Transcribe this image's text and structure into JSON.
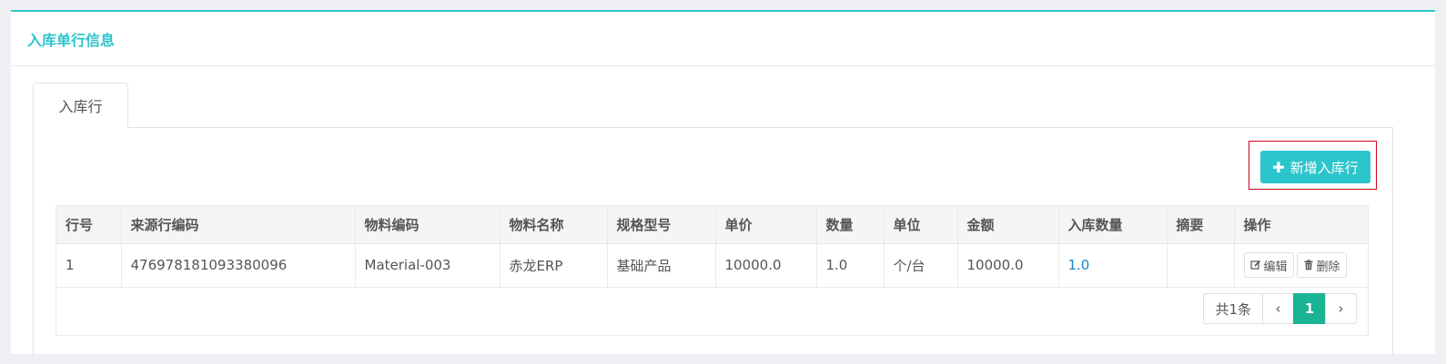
{
  "panel": {
    "title": "入库单行信息"
  },
  "tabs": [
    {
      "label": "入库行"
    }
  ],
  "toolbar": {
    "add_label": "新增入库行",
    "add_icon": "plus-icon"
  },
  "table": {
    "columns": [
      "行号",
      "来源行编码",
      "物料编码",
      "物料名称",
      "规格型号",
      "单价",
      "数量",
      "单位",
      "金额",
      "入库数量",
      "摘要",
      "操作"
    ],
    "rows": [
      {
        "line_no": "1",
        "source_code": "476978181093380096",
        "material_code": "Material-003",
        "material_name": "赤龙ERP",
        "spec": "基础产品",
        "unit_price": "10000.0",
        "quantity": "1.0",
        "unit": "个/台",
        "amount": "10000.0",
        "in_quantity": "1.0",
        "summary": "",
        "edit_label": "编辑",
        "delete_label": "删除"
      }
    ]
  },
  "pagination": {
    "total_label": "共1条",
    "prev": "‹",
    "current_page": "1",
    "next": "›"
  },
  "colors": {
    "accent": "#2cc5cc",
    "page_active": "#1ab394",
    "link": "#1c84c6",
    "highlight_box": "#d0021b"
  }
}
